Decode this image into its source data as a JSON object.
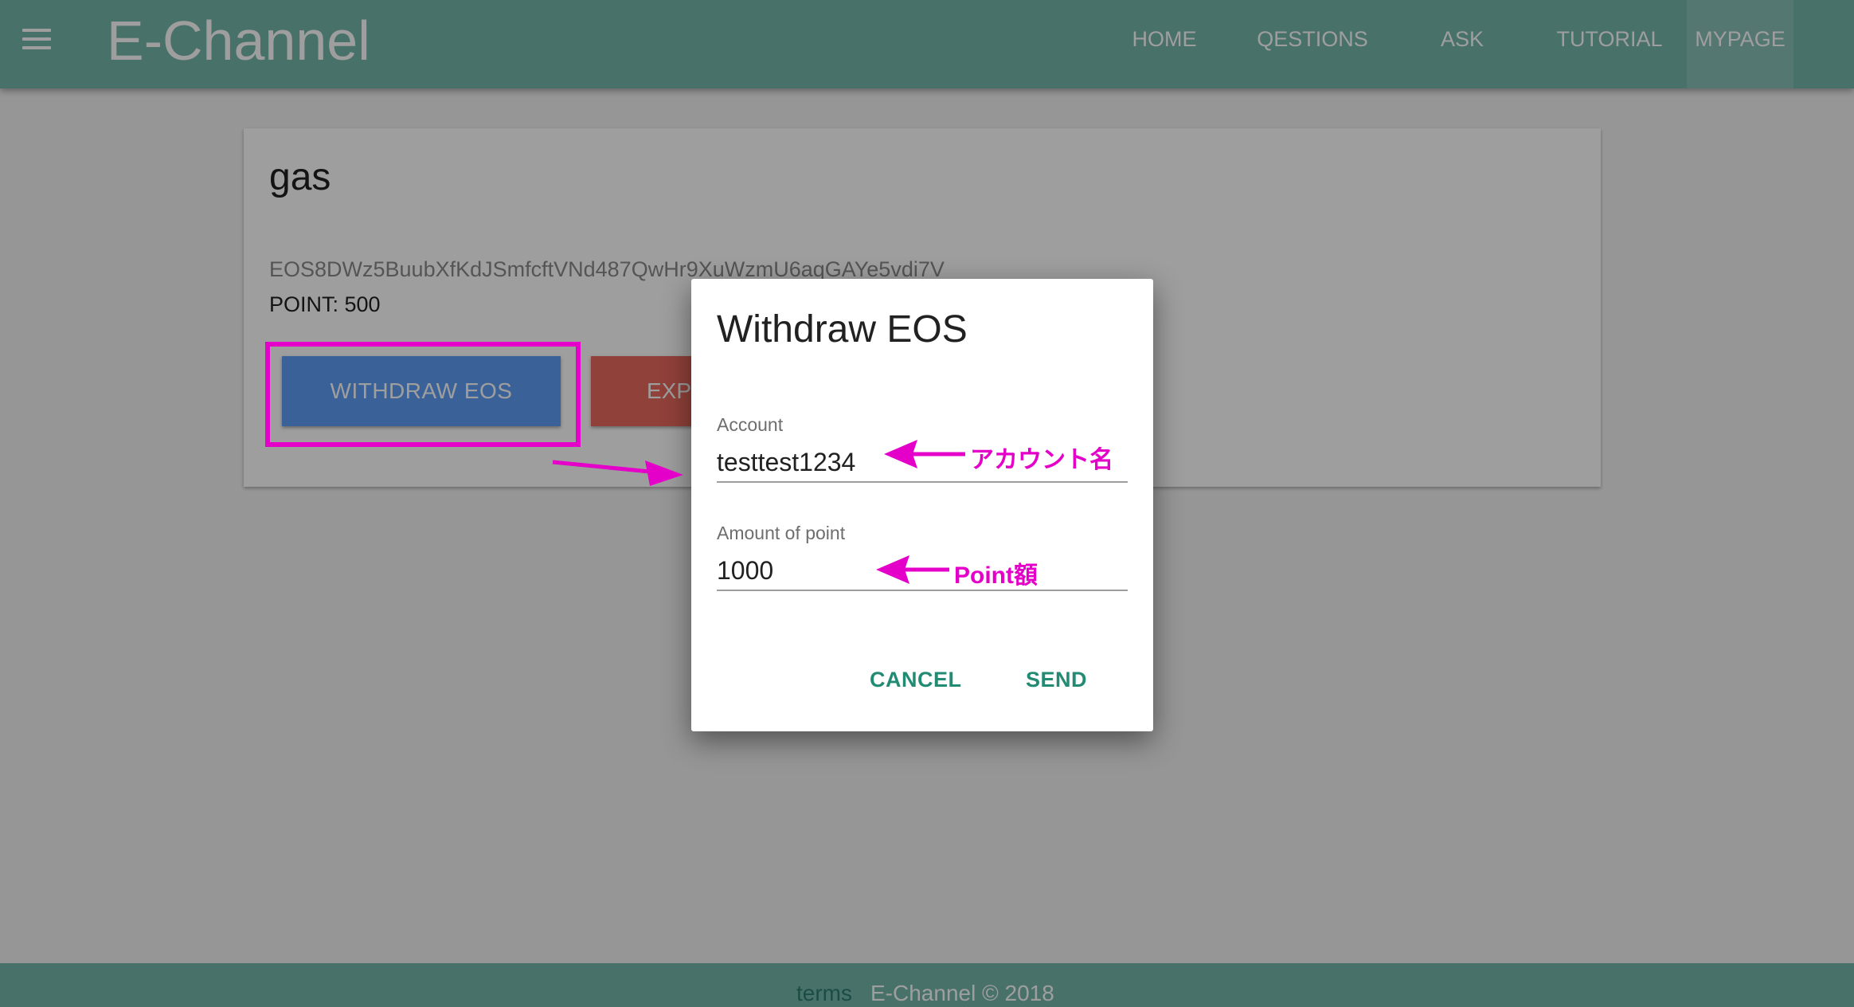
{
  "header": {
    "title": "E-Channel",
    "nav": [
      {
        "label": "HOME"
      },
      {
        "label": "QESTIONS"
      },
      {
        "label": "ASK"
      },
      {
        "label": "TUTORIAL"
      },
      {
        "label": "MYPAGE",
        "active": true
      }
    ]
  },
  "card": {
    "title": "gas",
    "address": "EOS8DWz5BuubXfKdJSmfcftVNd487QwHr9XuWzmU6aqGAYe5vdi7V",
    "point": "POINT: 500",
    "withdraw_label": "WITHDRAW EOS",
    "export_label": "EXPO"
  },
  "dialog": {
    "title": "Withdraw EOS",
    "account_label": "Account",
    "account_value": "testtest1234",
    "amount_label": "Amount of point",
    "amount_value": "1000",
    "cancel_label": "CANCEL",
    "send_label": "SEND"
  },
  "annotations": {
    "account_note": "アカウント名",
    "amount_note": "Point額",
    "color": "#e400c9"
  },
  "footer": {
    "terms": "terms",
    "copyright": "E-Channel © 2018"
  },
  "colors": {
    "appbar": "#75b6aa",
    "withdraw_button": "#5e9ff5",
    "export_button": "#e86a5c",
    "dialog_action": "#238a74"
  },
  "icons": {
    "menu": "hamburger-menu-icon"
  }
}
